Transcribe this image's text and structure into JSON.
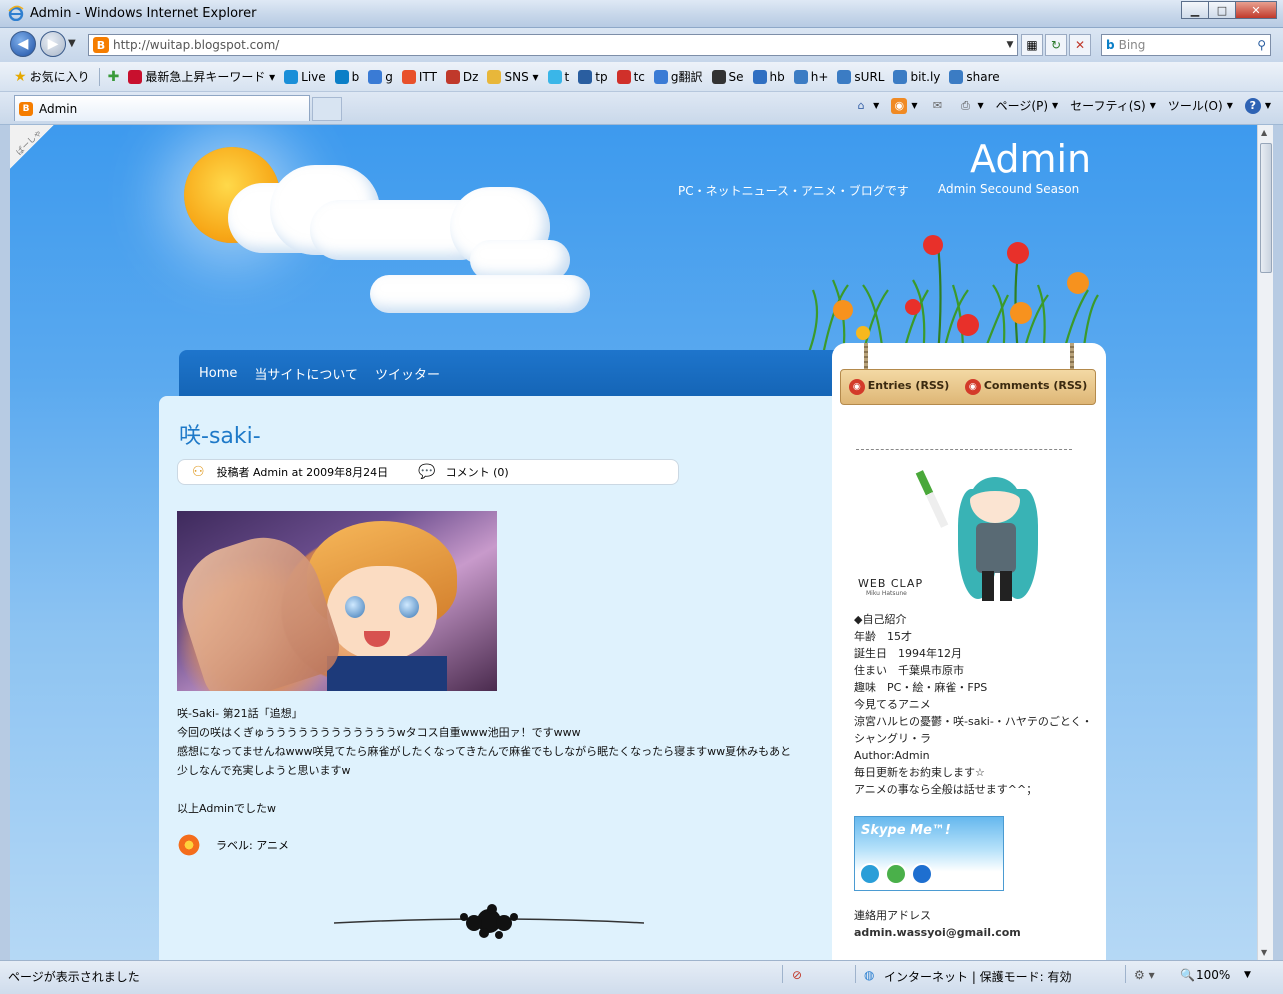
{
  "window": {
    "title": "Admin - Windows Internet Explorer",
    "min": "▁",
    "max": "□",
    "close": "✕"
  },
  "address": {
    "url": "http://wuitap.blogspot.com/"
  },
  "search": {
    "placeholder": "Bing"
  },
  "favorites": {
    "label": "お気に入り",
    "items": [
      {
        "label": "最新急上昇キーワード ▾",
        "icon": "yahoo-icon",
        "color": "#c8102e"
      },
      {
        "label": "Live",
        "icon": "windows-icon",
        "color": "#1a8fd8"
      },
      {
        "label": "b",
        "icon": "bing-icon",
        "color": "#0b7fc7"
      },
      {
        "label": "g",
        "icon": "google-icon",
        "color": "#3a7bd5"
      },
      {
        "label": "ITT",
        "icon": "itt-icon",
        "color": "#e8502a"
      },
      {
        "label": "Dz",
        "icon": "dz-icon",
        "color": "#c0392b"
      },
      {
        "label": "SNS ▾",
        "icon": "folder-icon",
        "color": "#e8b73a"
      },
      {
        "label": "t",
        "icon": "twitter-icon",
        "color": "#3ab6e8"
      },
      {
        "label": "tp",
        "icon": "tp-icon",
        "color": "#2a5ea0"
      },
      {
        "label": "tc",
        "icon": "tc-icon",
        "color": "#d0302a"
      },
      {
        "label": "g翻訳",
        "icon": "google-icon",
        "color": "#3a7bd5"
      },
      {
        "label": "Se",
        "icon": "se-icon",
        "color": "#333333"
      },
      {
        "label": "hb",
        "icon": "hatena-icon",
        "color": "#2f6fc2"
      },
      {
        "label": "h+",
        "icon": "page-icon",
        "color": "#3b7cc4"
      },
      {
        "label": "sURL",
        "icon": "page-icon",
        "color": "#3b7cc4"
      },
      {
        "label": "bit.ly",
        "icon": "page-icon",
        "color": "#3b7cc4"
      },
      {
        "label": "share",
        "icon": "page-icon",
        "color": "#3b7cc4"
      }
    ]
  },
  "tabs": [
    {
      "label": "Admin"
    }
  ],
  "commands": {
    "page": "ページ(P)",
    "safety": "セーフティ(S)",
    "tools": "ツール(O)",
    "help": "?"
  },
  "site": {
    "title": "Admin",
    "subtitle": "PC・ネットニュース・アニメ・ブログです",
    "season": "Admin Secound Season",
    "corner": "ぱーしゃ"
  },
  "nav": [
    {
      "label": "Home"
    },
    {
      "label": "当サイトについて"
    },
    {
      "label": "ツイッター"
    }
  ],
  "post": {
    "title": "咲-saki-",
    "author": "投稿者 Admin at 2009年8月24日",
    "comments": "コメント (0)",
    "body": [
      "咲-Saki- 第21話「追想」",
      "今回の咲はくぎゅううううううううううううwタコス自重www池田ァ！ですwww",
      "感想になってませんねwww咲見てたら麻雀がしたくなってきたんで麻雀でもしながら眠たくなったら寝ますww夏休みもあと",
      "少しなんで充実しようと思いますw",
      "",
      "以上Adminでしたw"
    ],
    "label": "ラベル: アニメ"
  },
  "sidebar": {
    "rss_entries": "Entries (RSS)",
    "rss_comments": "Comments (RSS)",
    "webclap": "WEB CLAP",
    "webclap_sub": "Miku Hatsune",
    "profile": [
      "◆自己紹介",
      "年齢　15才",
      "誕生日　1994年12月",
      "住まい　千葉県市原市",
      "趣味　PC・絵・麻雀・FPS",
      "今見てるアニメ",
      "涼宮ハルヒの憂鬱・咲-saki-・ハヤテのごとく・",
      "シャングリ・ラ",
      "Author:Admin",
      "毎日更新をお約束します☆",
      "アニメの事なら全般は話せます^^；"
    ],
    "skype": "Skype Me™!",
    "contact_label": "連絡用アドレス",
    "contact_email": "admin.wassyoi@gmail.com"
  },
  "status": {
    "text": "ページが表示されました",
    "zone": "インターネット | 保護モード: 有効",
    "zoom": "100%"
  }
}
